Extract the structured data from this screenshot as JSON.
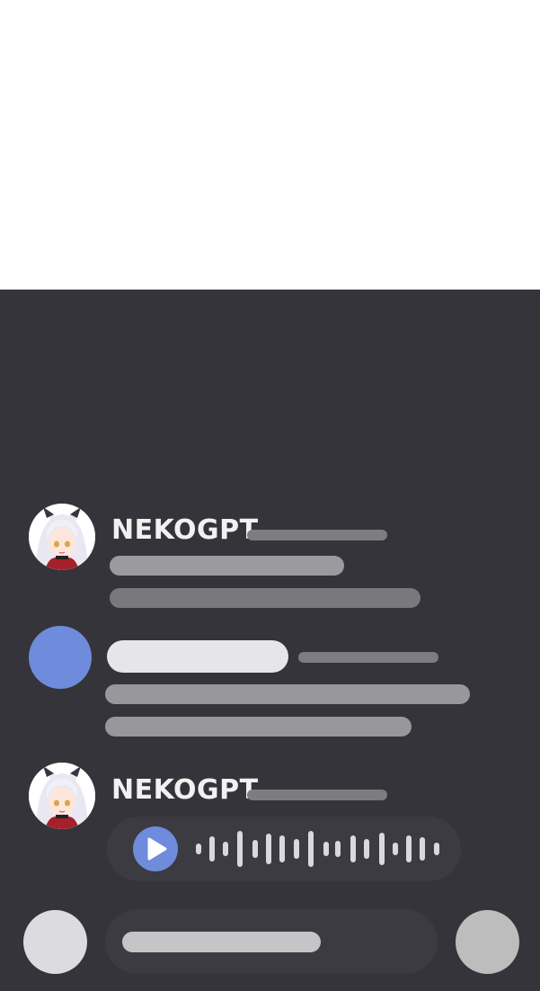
{
  "messages": [
    {
      "author": "NEKOGPT",
      "avatar": "neko-avatar"
    },
    {
      "author": "",
      "avatar": "user-avatar"
    },
    {
      "author": "NEKOGPT",
      "avatar": "neko-avatar",
      "type": "voice-message"
    }
  ],
  "colors": {
    "panel": "#35343a",
    "accent": "#6f8bdc",
    "username": "#f1f1f1"
  }
}
